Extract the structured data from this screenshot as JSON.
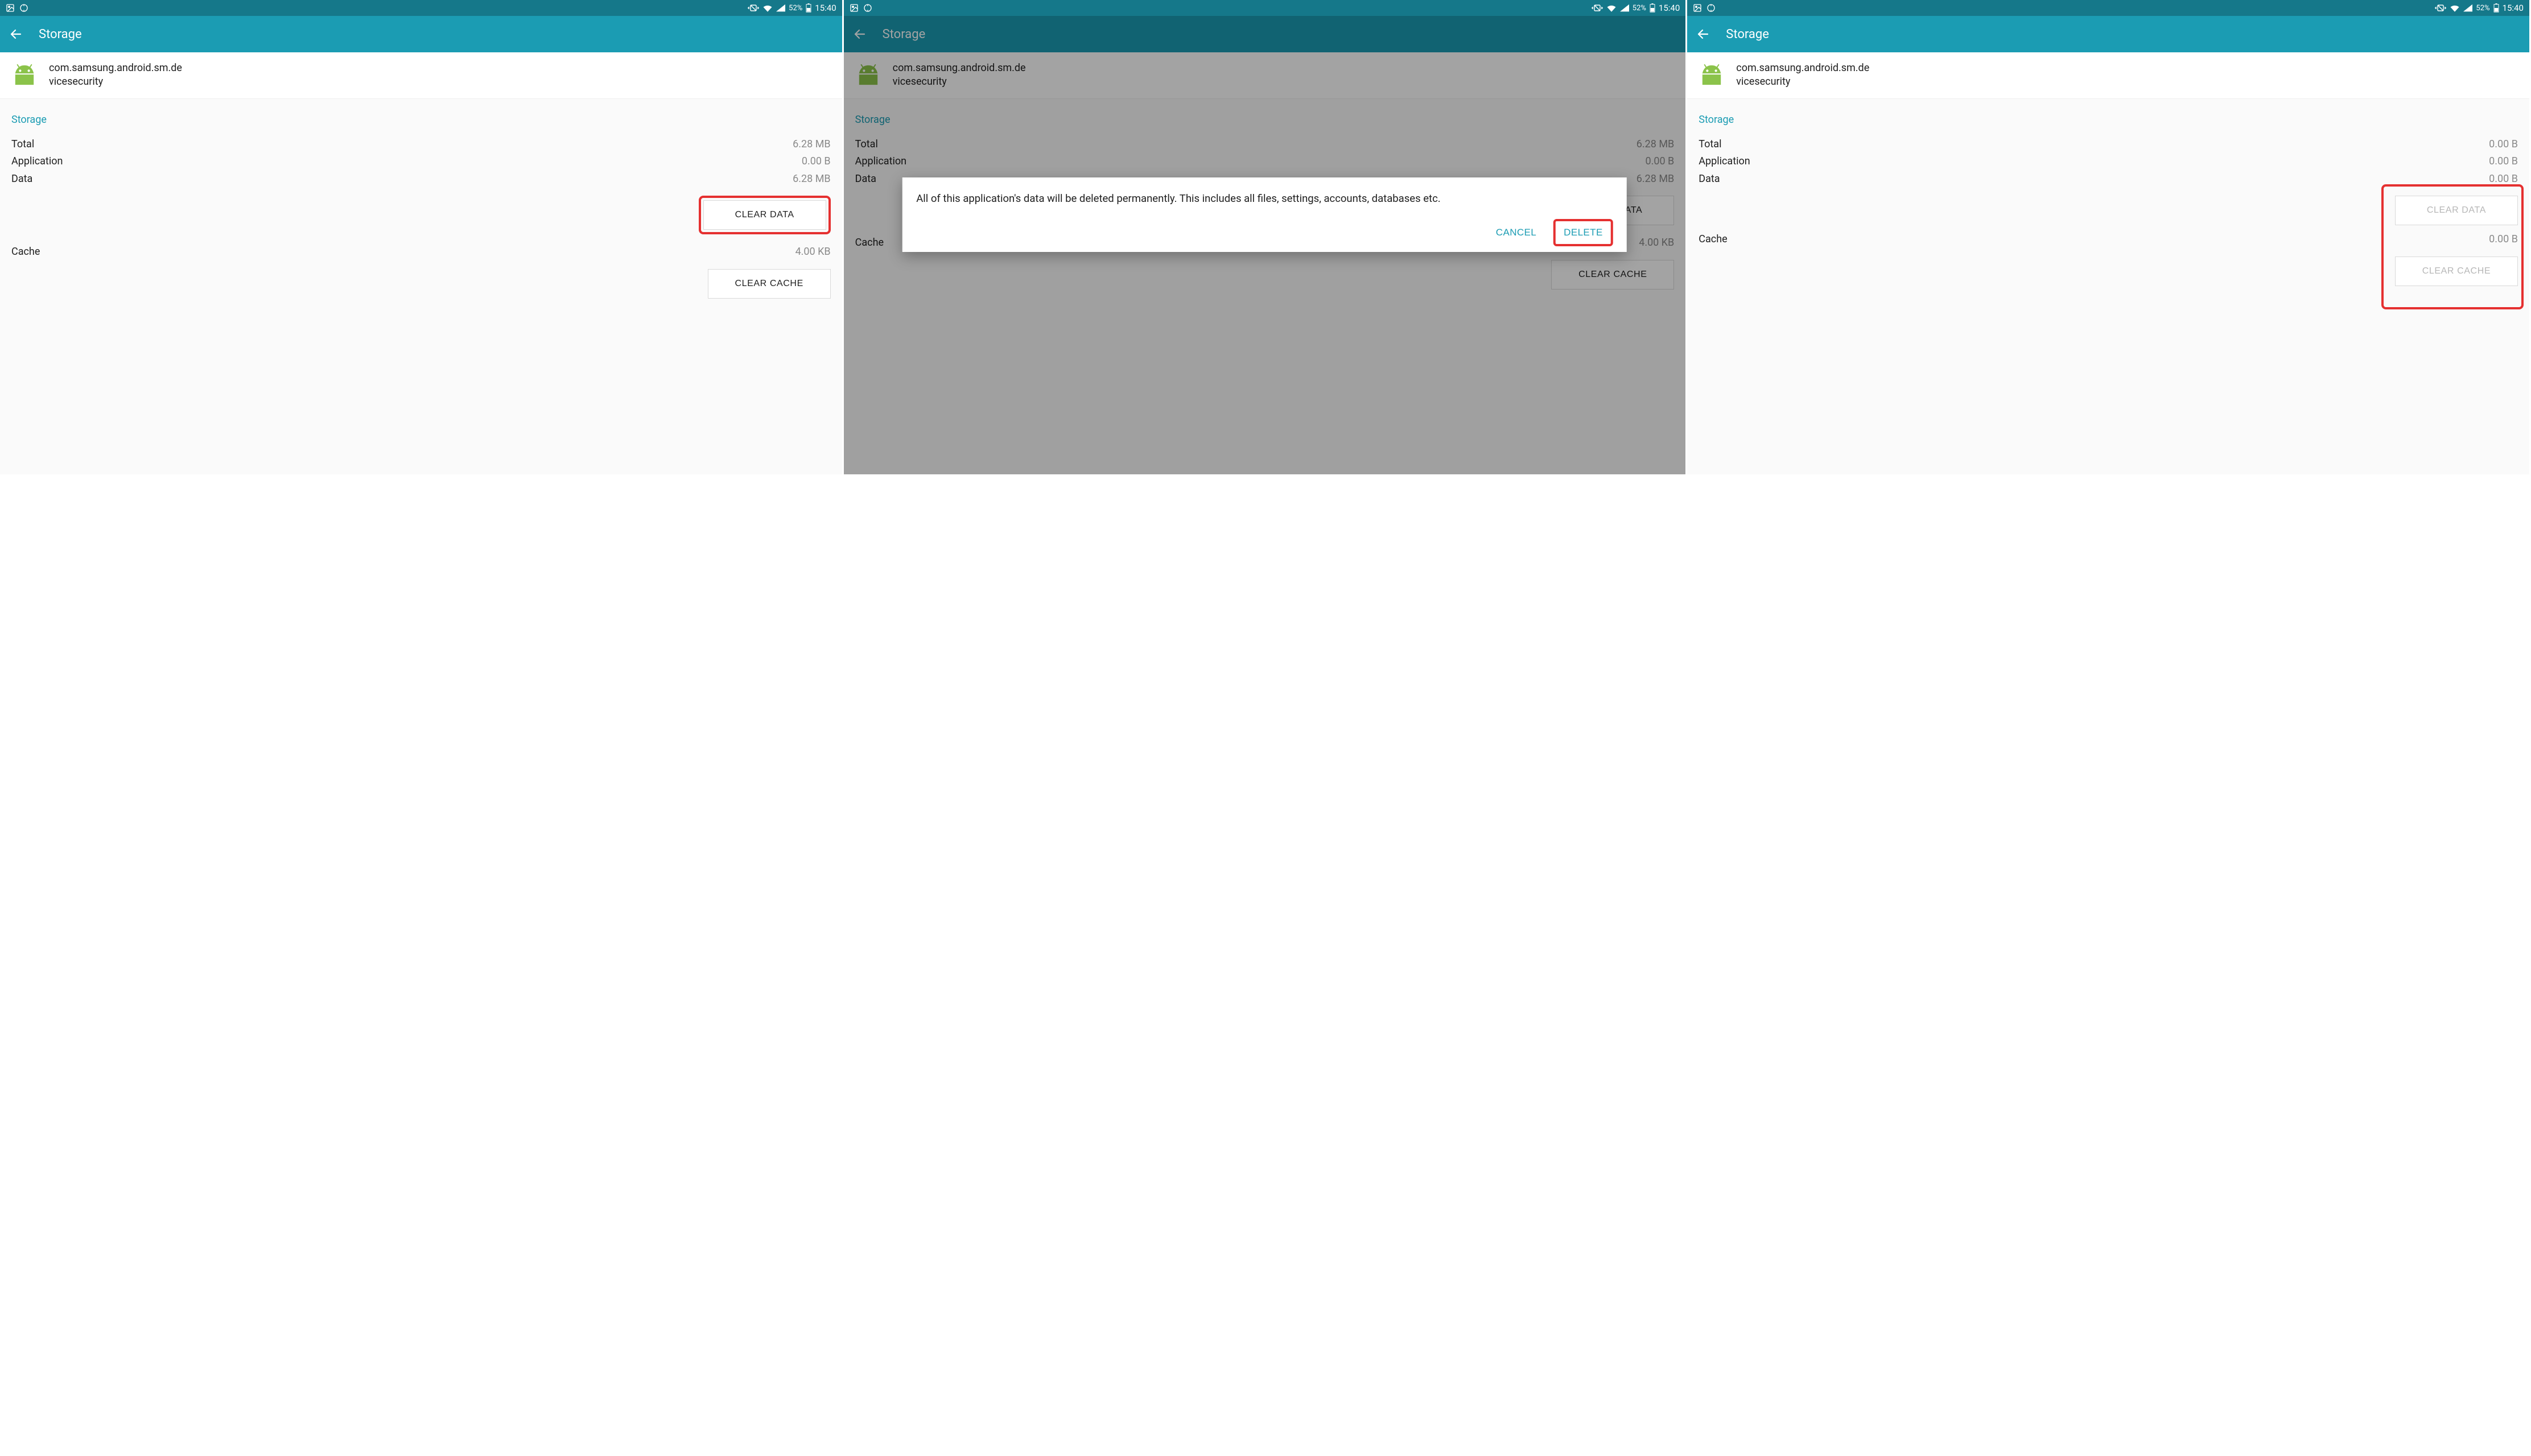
{
  "status": {
    "battery_pct": "52%",
    "time": "15:40"
  },
  "header": {
    "title": "Storage"
  },
  "app": {
    "package_line1": "com.samsung.android.sm.de",
    "package_line2": "vicesecurity"
  },
  "section": {
    "title": "Storage",
    "total_label": "Total",
    "application_label": "Application",
    "data_label": "Data",
    "cache_label": "Cache",
    "clear_data_btn": "CLEAR DATA",
    "clear_cache_btn": "CLEAR CACHE"
  },
  "screen1": {
    "total": "6.28 MB",
    "application": "0.00 B",
    "data": "6.28 MB",
    "cache": "4.00 KB"
  },
  "screen2": {
    "dialog_text": "All of this application's data will be deleted permanently. This includes all files, settings, accounts, databases etc.",
    "cancel": "CANCEL",
    "delete": "DELETE"
  },
  "screen3": {
    "total": "0.00 B",
    "application": "0.00 B",
    "data": "0.00 B",
    "cache": "0.00 B"
  }
}
